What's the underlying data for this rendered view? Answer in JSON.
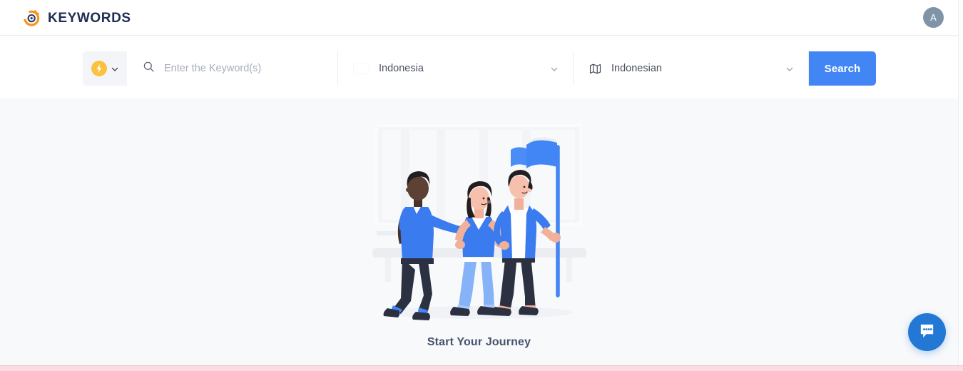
{
  "header": {
    "brand_name": "KEYWORDS",
    "brand_icon": "keywords-logo-icon",
    "avatar_initial": "A"
  },
  "search": {
    "type_icon": "lightning-bolt-icon",
    "type_chevron_icon": "chevron-down-icon",
    "keyword_value": "",
    "keyword_placeholder": "Enter the Keyword(s)",
    "search_icon": "search-icon",
    "country": {
      "label": "Indonesia",
      "flag_icon": "flag-indonesia-icon",
      "chevron_icon": "chevron-down-icon"
    },
    "language": {
      "label": "Indonesian",
      "icon": "map-icon",
      "chevron_icon": "chevron-down-icon"
    },
    "submit_label": "Search"
  },
  "main": {
    "empty_title": "Start Your Journey",
    "illustration_name": "three-people-with-flag-illustration"
  },
  "chat": {
    "icon": "chat-bubble-icon"
  },
  "colors": {
    "accent_blue": "#4285f4",
    "brand_navy": "#1f2d52",
    "brand_orange": "#f7941e",
    "bolt_yellow": "#fcc13f",
    "flag_red": "#e8112d",
    "chat_blue": "#2278d4",
    "page_bg": "#f7f9fb",
    "bottom_strip": "#f9dde3"
  }
}
